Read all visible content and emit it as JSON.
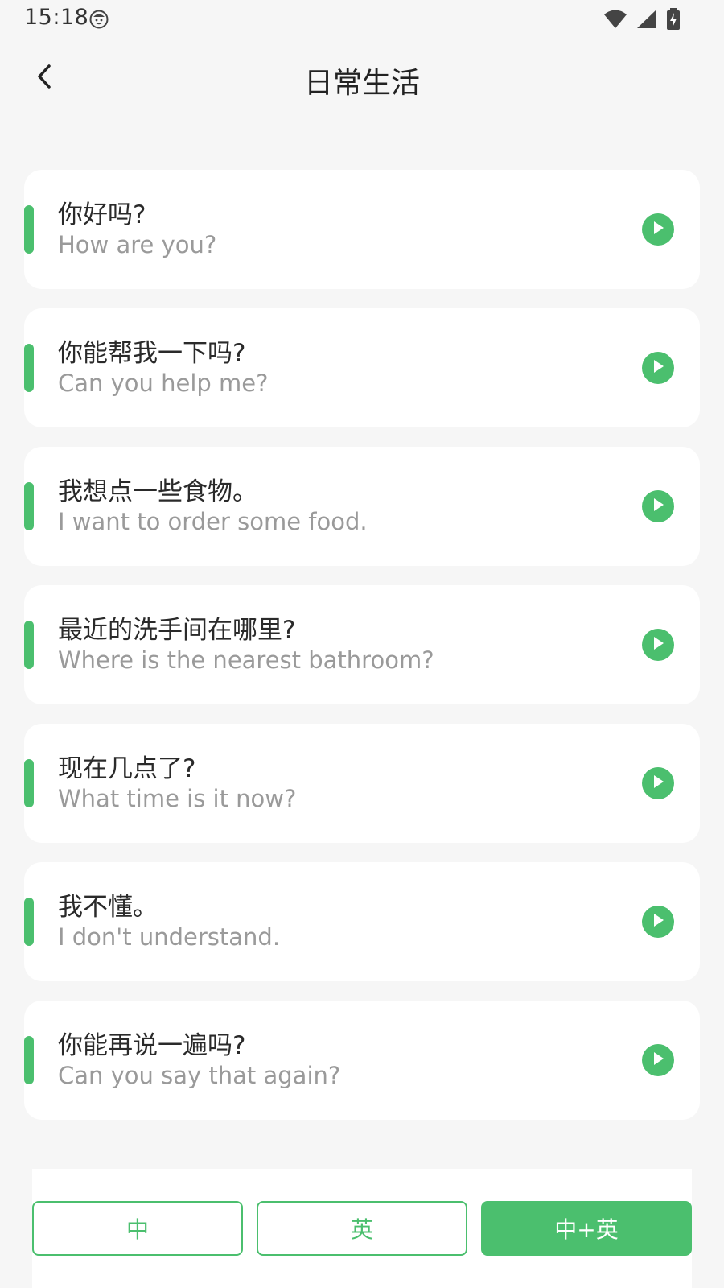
{
  "status_bar": {
    "time": "15:18",
    "icons": [
      "face-icon",
      "wifi-icon",
      "cell-signal-icon",
      "battery-charging-icon"
    ]
  },
  "header": {
    "title": "日常生活",
    "back_icon": "chevron-left-icon"
  },
  "phrases": [
    {
      "zh": "你好吗?",
      "en": "How are you?"
    },
    {
      "zh": "你能帮我一下吗?",
      "en": "Can you help me?"
    },
    {
      "zh": "我想点一些食物。",
      "en": "I want to order some food."
    },
    {
      "zh": "最近的洗手间在哪里?",
      "en": "Where is the nearest bathroom?"
    },
    {
      "zh": "现在几点了?",
      "en": "What time is it now?"
    },
    {
      "zh": "我不懂。",
      "en": "I don't understand."
    },
    {
      "zh": "你能再说一遍吗?",
      "en": "Can you say that again?"
    }
  ],
  "bottom_bar": {
    "modes": [
      {
        "label": "中",
        "active": false
      },
      {
        "label": "英",
        "active": false
      },
      {
        "label": "中+英",
        "active": true
      }
    ]
  },
  "colors": {
    "accent": "#4bbf6e",
    "background": "#f6f6f6",
    "card": "#ffffff",
    "text_primary": "#2a2a2a",
    "text_secondary": "#9a9a9a"
  }
}
